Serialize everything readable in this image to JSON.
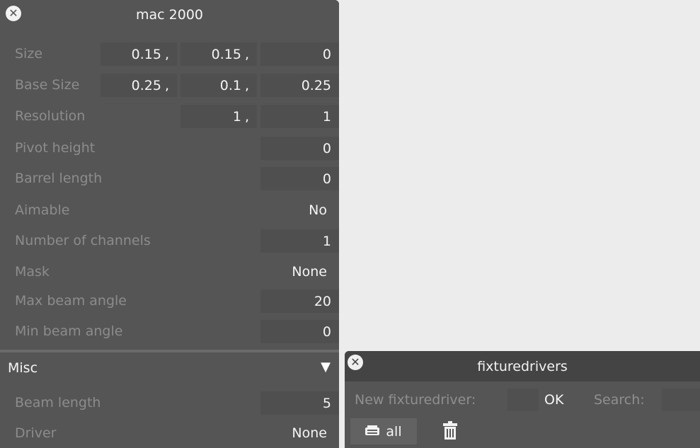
{
  "mac_panel": {
    "title": "mac 2000",
    "rows": [
      {
        "label": "Size",
        "values": [
          "0.15",
          "0.15",
          "0"
        ]
      },
      {
        "label": "Base Size",
        "values": [
          "0.25",
          "0.1",
          "0.25"
        ]
      },
      {
        "label": "Resolution",
        "values": [
          "1",
          "1"
        ]
      },
      {
        "label": "Pivot height",
        "value": "0"
      },
      {
        "label": "Barrel length",
        "value": "0"
      },
      {
        "label": "Aimable",
        "value": "No"
      },
      {
        "label": "Number of channels",
        "value": "1"
      },
      {
        "label": "Mask",
        "value": "None"
      },
      {
        "label": "Max beam angle",
        "value": "20"
      },
      {
        "label": "Min beam angle",
        "value": "0"
      }
    ],
    "misc": {
      "header": "Misc",
      "rows": [
        {
          "label": "Beam length",
          "value": "5"
        },
        {
          "label": "Driver",
          "value": "None"
        }
      ]
    },
    "separator": ","
  },
  "fixturedrivers_panel": {
    "title": "fixturedrivers",
    "new_label": "New fixturedriver:",
    "new_value": "",
    "ok_label": "OK",
    "search_label": "Search:",
    "search_value": "",
    "all_label": "all"
  },
  "colors": {
    "panel_bg": "#555555",
    "field_bg": "#4f4f4f",
    "label_text": "#8c8c8c",
    "value_text": "#f4f4f4",
    "page_bg": "#ececec"
  },
  "icons": {
    "close": "close-icon",
    "triangle": "triangle-down-icon",
    "list": "list-icon",
    "trash": "trash-icon"
  }
}
